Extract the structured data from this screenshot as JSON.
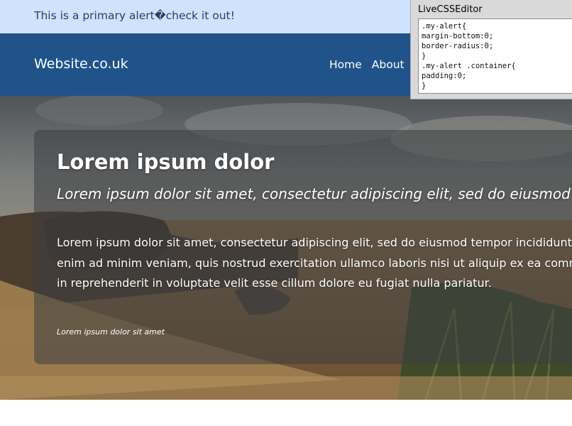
{
  "alert": {
    "text": "This is a primary alert�check it out!"
  },
  "navbar": {
    "brand": "Website.co.uk",
    "links": [
      "Home",
      "About"
    ]
  },
  "hero": {
    "title": "Lorem ipsum dolor",
    "subtitle": "Lorem ipsum dolor sit amet, consectetur adipiscing elit, sed do eiusmod",
    "body_lines": [
      "Lorem ipsum dolor sit amet, consectetur adipiscing elit, sed do eiusmod tempor incididunt ut labore et dolore magna aliqua. Ut",
      "enim ad minim veniam, quis nostrud exercitation ullamco laboris nisi ut aliquip ex ea commodo consequat. Duis aute irure dolor",
      "in reprehenderit in voluptate velit esse cillum dolore eu fugiat nulla pariatur."
    ],
    "note": "Lorem ipsum dolor sit amet"
  },
  "css_editor": {
    "title": "LiveCSSEditor",
    "lines": [
      ".my-alert{",
      "margin-bottom:0;",
      "border-radius:0;",
      "}",
      ".my-alert .container{",
      "padding:0;",
      "}"
    ]
  },
  "colors": {
    "alert_bg": "#cfe2ff",
    "navbar_bg": "#20538a"
  }
}
